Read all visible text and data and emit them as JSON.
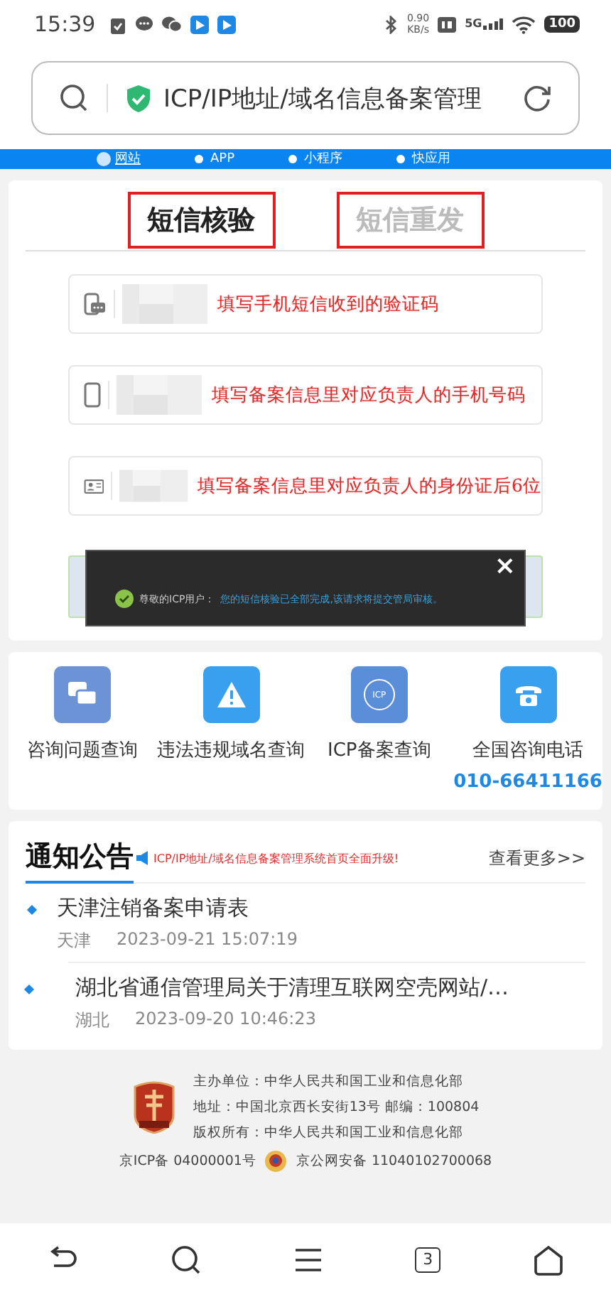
{
  "status_bar": {
    "time": "15:39",
    "net_speed": "0.90",
    "net_unit": "KB/s",
    "network": "5G",
    "battery": "100"
  },
  "address_bar": {
    "title": "ICP/IP地址/域名信息备案管理"
  },
  "type_options": [
    {
      "label": "网站",
      "selected": true
    },
    {
      "label": "APP",
      "selected": false
    },
    {
      "label": "小程序",
      "selected": false
    },
    {
      "label": "快应用",
      "selected": false
    }
  ],
  "tabs": [
    {
      "label": "短信核验",
      "selected": true
    },
    {
      "label": "短信重发",
      "selected": false
    }
  ],
  "fields": [
    {
      "kind": "sms",
      "annotation": "填写手机短信收到的验证码"
    },
    {
      "kind": "phone",
      "annotation": "填写备案信息里对应负责人的手机号码"
    },
    {
      "kind": "id",
      "annotation": "填写备案信息里对应负责人的身份证后6位"
    }
  ],
  "toast": {
    "close": "×",
    "greeting": "尊敬的ICP用户：",
    "message": "您的短信核验已全部完成,该请求将提交管局审核。"
  },
  "quick_links": [
    {
      "kind": "chat",
      "label": "咨询问题查询"
    },
    {
      "kind": "warning",
      "label": "违法违规域名查询"
    },
    {
      "kind": "icp",
      "label": "ICP备案查询",
      "badge": "ICP"
    },
    {
      "kind": "phone",
      "label": "全国咨询电话",
      "phone": "010-66411166"
    }
  ],
  "notices": {
    "title": "通知公告",
    "marquee": "ICP/IP地址/域名信息备案管理系统首页全面升级!",
    "more": "查看更多>>",
    "items": [
      {
        "title": "天津注销备案申请表",
        "region": "天津",
        "date": "2023-09-21 15:07:19"
      },
      {
        "title": "湖北省通信管理局关于清理互联网空壳网站/…",
        "region": "湖北",
        "date": "2023-09-20 10:46:23"
      }
    ]
  },
  "footer": {
    "lines": [
      "主办单位：中华人民共和国工业和信息化部",
      "地址：中国北京西长安街13号 邮编：100804",
      "版权所有：中华人民共和国工业和信息化部"
    ],
    "icp": "京ICP备 04000001号",
    "police": "京公网安备 11040102700068"
  },
  "bottom_nav": {
    "tab_count": "3"
  }
}
